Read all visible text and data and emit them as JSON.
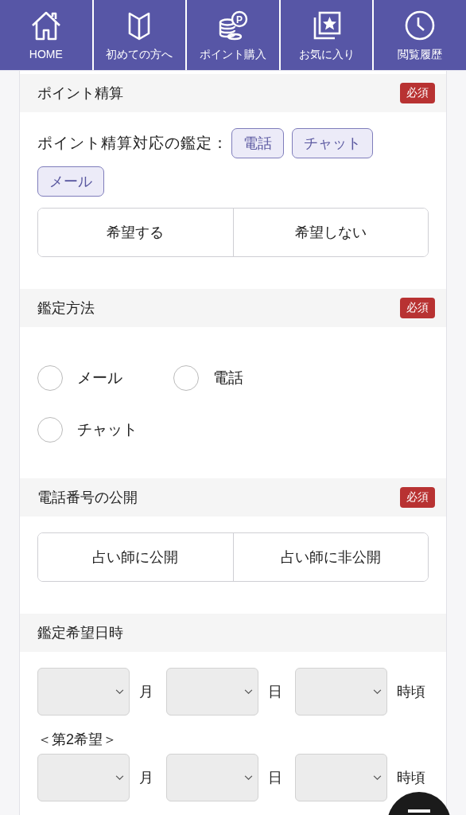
{
  "nav": [
    {
      "label": "HOME"
    },
    {
      "label": "初めての方へ"
    },
    {
      "label": "ポイント購入",
      "icon_text": "P"
    },
    {
      "label": "お気に入り"
    },
    {
      "label": "閲覧履歴"
    }
  ],
  "sections": [
    {
      "title": "ポイント精算",
      "badge": "必須",
      "kind": "toggle",
      "note": "ポイント精算対応の鑑定：",
      "tags": [
        "電話",
        "チャット",
        "メール"
      ],
      "options": [
        {
          "label": "希望する",
          "selected": false
        },
        {
          "label": "希望しない",
          "selected": false
        }
      ]
    },
    {
      "title": "鑑定方法",
      "badge": "必須",
      "kind": "radio",
      "options": [
        {
          "label": "メール",
          "selected": false
        },
        {
          "label": "電話",
          "selected": false
        },
        {
          "label": "チャット",
          "selected": false
        }
      ]
    },
    {
      "title": "電話番号の公開",
      "badge": "必須",
      "kind": "toggle",
      "options": [
        {
          "label": "占い師に公開",
          "selected": false
        },
        {
          "label": "占い師に非公開",
          "selected": false
        }
      ]
    },
    {
      "title": "鑑定希望日時",
      "kind": "date",
      "rows": [
        {
          "units": [
            "月",
            "日",
            "時頃"
          ]
        },
        {
          "heading": "＜第2希望＞",
          "units": [
            "月",
            "日",
            "時頃"
          ]
        }
      ]
    }
  ]
}
